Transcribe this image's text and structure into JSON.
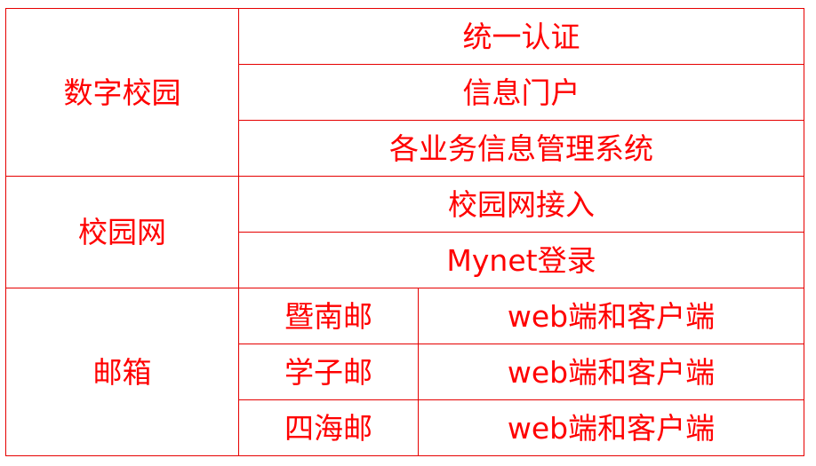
{
  "sections": [
    {
      "category": "数字校园",
      "items": [
        "统一认证",
        "信息门户",
        "各业务信息管理系统"
      ]
    },
    {
      "category": "校园网",
      "items": [
        "校园网接入",
        "Mynet登录"
      ]
    },
    {
      "category": "邮箱",
      "rows": [
        {
          "name": "暨南邮",
          "access": "web端和客户端"
        },
        {
          "name": "学子邮",
          "access": "web端和客户端"
        },
        {
          "name": "四海邮",
          "access": "web端和客户端"
        }
      ]
    }
  ],
  "colors": {
    "text": "#ff0000",
    "border": "#e60000"
  }
}
